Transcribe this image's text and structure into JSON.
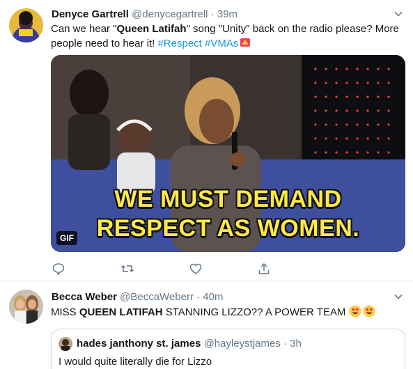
{
  "tweets": [
    {
      "author_name": "Denyce Gartrell",
      "handle": "@denycegartrell",
      "separator": "·",
      "time": "39m",
      "text_pre": "Can we hear \"",
      "text_bold": "Queen Latifah",
      "text_mid": "\" song \"Unity\" back on the radio please? More people need to hear it! ",
      "hashtag_1": "#Respect",
      "hashtag_2": "#VMAs",
      "gif": {
        "caption_line1": "WE MUST DEMAND",
        "caption_line2": "RESPECT AS WOMEN.",
        "badge": "GIF"
      },
      "actions": [
        "reply-icon",
        "retweet-icon",
        "like-icon",
        "share-icon"
      ]
    },
    {
      "author_name": "Becca Weber",
      "handle": "@BeccaWeberr",
      "separator": "·",
      "time": "40m",
      "text_pre": "MISS ",
      "text_bold": "QUEEN LATIFAH",
      "text_post": " STANNING LIZZO?? A POWER TEAM ",
      "emoji": "heart-eyes-emoji",
      "quoted": {
        "author_name": "hades janthony st. james",
        "handle": "@hayleystjames",
        "separator": "·",
        "time": "3h",
        "text": "I would quite literally die for Lizzo"
      }
    }
  ],
  "colors": {
    "link": "#1b95e0",
    "secondary_text": "#657786",
    "caption_yellow": "#ffe94a",
    "divider": "#e6ecf0"
  }
}
